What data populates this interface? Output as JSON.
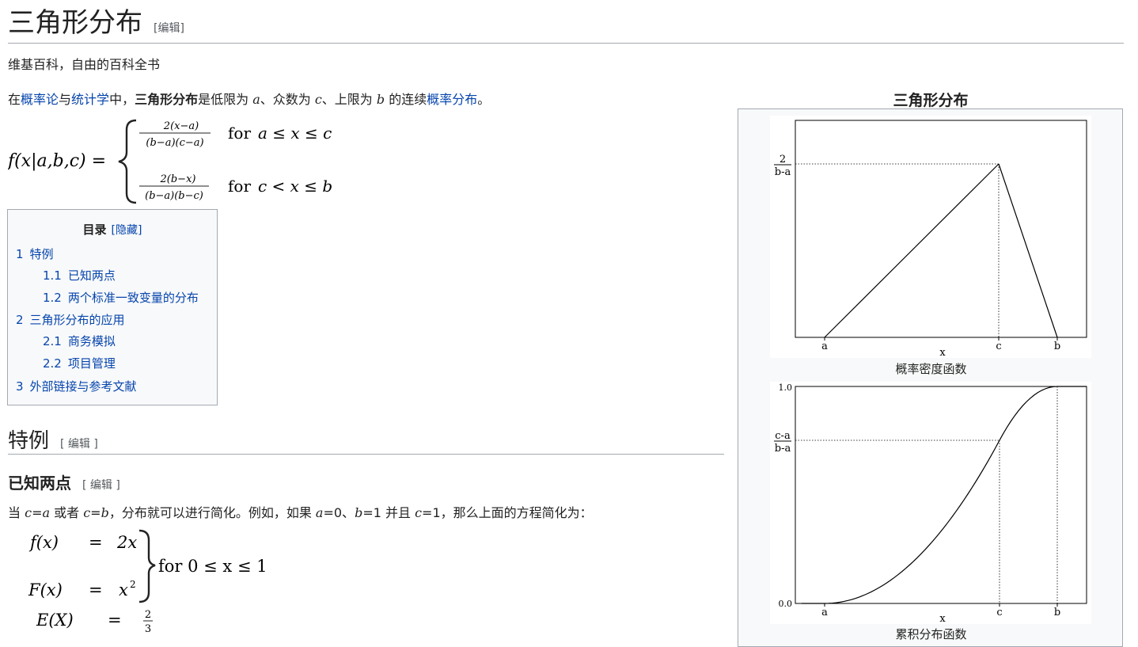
{
  "page": {
    "title": "三角形分布",
    "title_edit": "[编辑]",
    "tagline": "维基百科，自由的百科全书"
  },
  "intro": {
    "t1": "在",
    "link_probability": "概率论",
    "t2": "与",
    "link_statistics": "统计学",
    "t3": "中，",
    "bold_name": "三角形分布",
    "t4": "是低限为 ",
    "var_a": "a",
    "t5": "、众数为 ",
    "var_c": "c",
    "t6": "、上限为 ",
    "var_b": "b",
    "t7": " 的连续",
    "link_distribution": "概率分布",
    "t8": "。"
  },
  "pdf_formula": {
    "lhs": "f(x|a,b,c) =",
    "case1_num": "2(x−a)",
    "case1_den": "(b−a)(c−a)",
    "case1_for": "for",
    "case1_cond": "a ≤ x ≤ c",
    "case2_num": "2(b−x)",
    "case2_den": "(b−a)(b−c)",
    "case2_for": "for",
    "case2_cond": "c < x ≤ b"
  },
  "toc": {
    "title": "目录",
    "toggle": "[隐藏]",
    "items": [
      {
        "num": "1",
        "label": "特例"
      },
      {
        "num": "1.1",
        "label": "已知两点"
      },
      {
        "num": "1.2",
        "label": "两个标准一致变量的分布"
      },
      {
        "num": "2",
        "label": "三角形分布的应用"
      },
      {
        "num": "2.1",
        "label": "商务模拟"
      },
      {
        "num": "2.2",
        "label": "项目管理"
      },
      {
        "num": "3",
        "label": "外部链接与参考文献"
      }
    ]
  },
  "section_special": {
    "title": "特例",
    "edit": "[ 编辑 ]"
  },
  "section_two_points": {
    "title": "已知两点",
    "edit": "[ 编辑 ]",
    "p1": "当 ",
    "v1": "c",
    "p2": "=",
    "v2": "a",
    "p3": " 或者 ",
    "v3": "c",
    "p4": "=",
    "v4": "b",
    "p5": "，分布就可以进行简化。例如，如果 ",
    "v5": "a",
    "p6": "=0、",
    "v6": "b",
    "p7": "=1 并且 ",
    "v7": "c",
    "p8": "=1，那么上面的方程简化为："
  },
  "formula2": {
    "f_lhs": "f(x)",
    "eq": "=",
    "f_rhs": "2x",
    "F_lhs": "F(x)",
    "F_rhs": "x",
    "F_exp": "2",
    "cond": "for 0 ≤ x ≤ 1",
    "E_lhs": "E(X)",
    "E_num": "2",
    "E_den": "3"
  },
  "infobox": {
    "caption": "三角形分布",
    "pdf_caption": "概率密度函数",
    "cdf_caption": "累积分布函数"
  },
  "chart_data": [
    {
      "type": "line",
      "x": [
        "a",
        "c",
        "b"
      ],
      "y": [
        "0",
        "2/(b-a)",
        "0"
      ],
      "xlabel": "x",
      "ylabel": "",
      "y_tick_labels": [
        "2",
        "b-a"
      ],
      "x_tick_labels": [
        "a",
        "c",
        "b"
      ]
    },
    {
      "type": "line",
      "x": [
        "a",
        "c",
        "b"
      ],
      "y": [
        0.0,
        "(c-a)/(b-a)",
        1.0
      ],
      "xlabel": "x",
      "ylabel": "",
      "y_tick_labels": [
        "1.0",
        "c-a",
        "b-a",
        "0.0"
      ],
      "x_tick_labels": [
        "a",
        "c",
        "b"
      ]
    }
  ],
  "colors": {
    "link": "#0645ad",
    "border": "#a2a9b1",
    "infobox_bg": "#f8f9fa"
  }
}
